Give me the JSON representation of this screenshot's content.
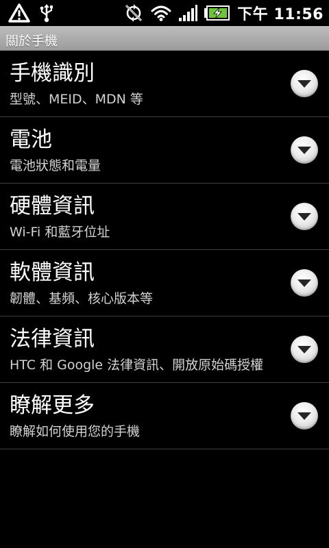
{
  "status_bar": {
    "icons_left": [
      "alert-icon",
      "usb-icon"
    ],
    "icons_right": [
      "sync-off-icon",
      "wifi-icon",
      "signal-icon",
      "battery-charging-icon"
    ],
    "clock": "下午 11:56"
  },
  "title_bar": {
    "title": "關於手機"
  },
  "menu": {
    "items": [
      {
        "title": "手機識別",
        "subtitle": "型號、MEID、MDN 等"
      },
      {
        "title": "電池",
        "subtitle": "電池狀態和電量"
      },
      {
        "title": "硬體資訊",
        "subtitle": "Wi-Fi 和藍牙位址"
      },
      {
        "title": "軟體資訊",
        "subtitle": "韌體、基頻、核心版本等"
      },
      {
        "title": "法律資訊",
        "subtitle": "HTC 和 Google 法律資訊、開放原始碼授權"
      },
      {
        "title": "瞭解更多",
        "subtitle": "瞭解如何使用您的手機"
      }
    ],
    "expand_icon": "chevron-down-icon"
  },
  "colors": {
    "background": "#000000",
    "title_bar": "#b0b0b0",
    "divider": "#3e3e3e",
    "subtitle_text": "#d2d2d2"
  }
}
